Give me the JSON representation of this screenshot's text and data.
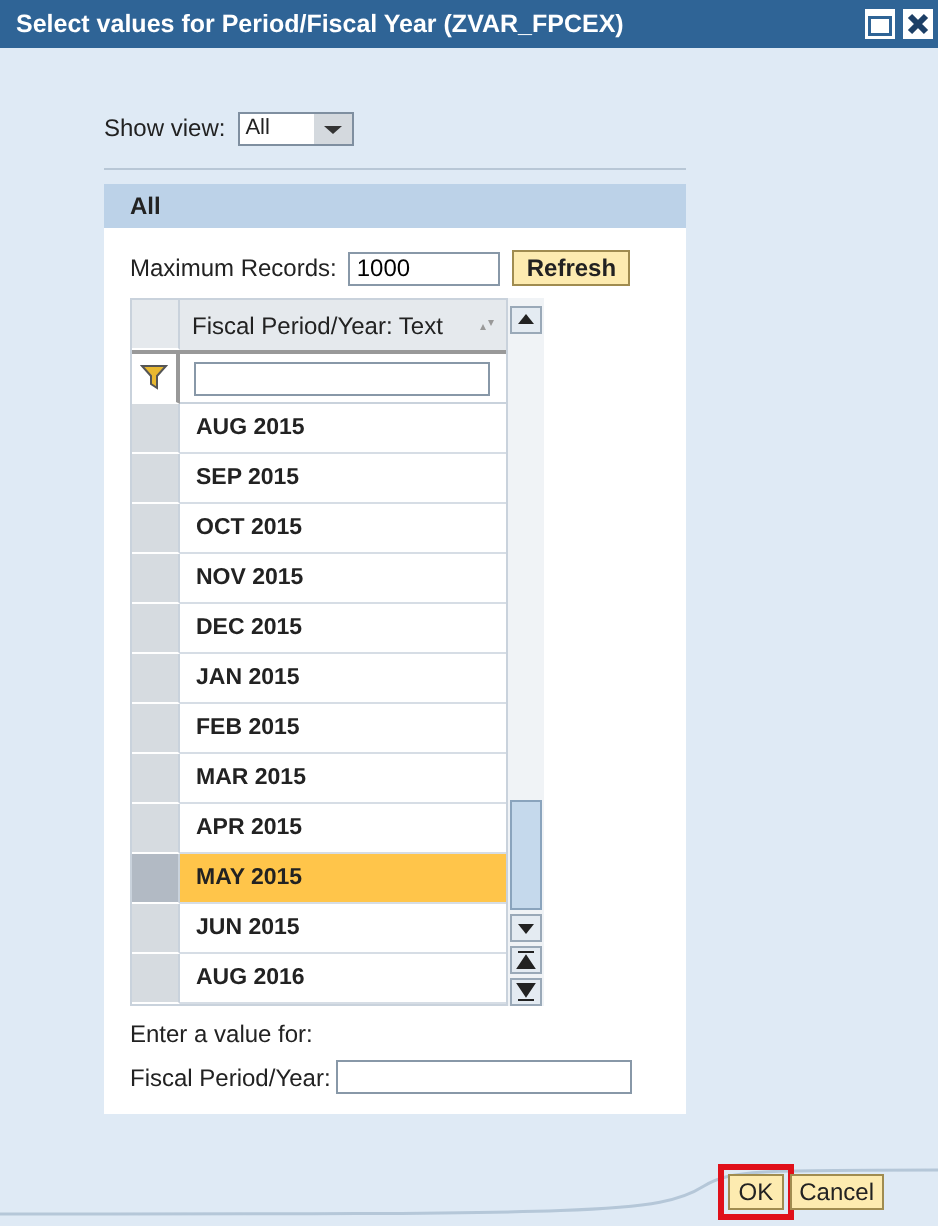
{
  "window": {
    "title": "Select values for Period/Fiscal Year (ZVAR_FPCEX)"
  },
  "show_view": {
    "label": "Show view:",
    "value": "All"
  },
  "panel": {
    "title": "All"
  },
  "max_records": {
    "label": "Maximum Records:",
    "value": "1000",
    "button": "Refresh"
  },
  "table": {
    "column": "Fiscal Period/Year: Text",
    "rows": [
      {
        "text": "AUG 2015",
        "selected": false
      },
      {
        "text": "SEP 2015",
        "selected": false
      },
      {
        "text": "OCT 2015",
        "selected": false
      },
      {
        "text": "NOV 2015",
        "selected": false
      },
      {
        "text": "DEC 2015",
        "selected": false
      },
      {
        "text": "JAN 2015",
        "selected": false
      },
      {
        "text": "FEB 2015",
        "selected": false
      },
      {
        "text": "MAR 2015",
        "selected": false
      },
      {
        "text": "APR 2015",
        "selected": false
      },
      {
        "text": "MAY 2015",
        "selected": true
      },
      {
        "text": "JUN 2015",
        "selected": false
      },
      {
        "text": "AUG 2016",
        "selected": false
      }
    ]
  },
  "entry": {
    "prompt": "Enter a value for:",
    "label": "Fiscal Period/Year:"
  },
  "buttons": [
    {
      "label": "OK",
      "highlighted": true
    },
    {
      "label": "Cancel",
      "highlighted": false
    }
  ]
}
